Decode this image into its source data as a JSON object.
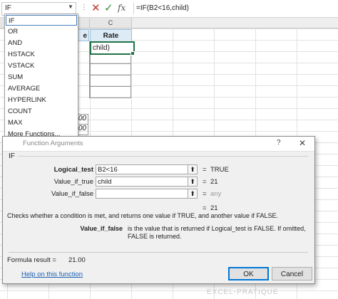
{
  "formula_bar": {
    "name_box": "IF",
    "formula": "=IF(B2<16,child)",
    "fx_label": "fx"
  },
  "columns": [
    "C"
  ],
  "sheet": {
    "header_partial": "e",
    "rate_header": "Rate",
    "active_cell_value": "child)",
    "partial_cells": [
      "00",
      "00"
    ]
  },
  "autocomplete": {
    "items": [
      "IF",
      "OR",
      "AND",
      "HSTACK",
      "VSTACK",
      "SUM",
      "AVERAGE",
      "HYPERLINK",
      "COUNT",
      "MAX",
      "More Functions..."
    ],
    "selected_index": 0
  },
  "dialog": {
    "title": "Function Arguments",
    "help_mark": "?",
    "close_mark": "✕",
    "function_name": "IF",
    "args": [
      {
        "label": "Logical_test",
        "value": "B2<16",
        "result": "TRUE",
        "bold": true
      },
      {
        "label": "Value_if_true",
        "value": "child",
        "result": "21",
        "bold": false
      },
      {
        "label": "Value_if_false",
        "value": "",
        "result": "any",
        "bold": false
      }
    ],
    "equals": "=",
    "overall_result": "21",
    "description": "Checks whether a condition is met, and returns one value if TRUE, and another value if FALSE.",
    "arg_desc_name": "Value_if_false",
    "arg_desc_text": "is the value that is returned if Logical_test is FALSE. If omitted, FALSE is returned.",
    "formula_result_label": "Formula result =",
    "formula_result_value": "21.00",
    "help_link": "Help on this function",
    "ok_label": "OK",
    "cancel_label": "Cancel"
  },
  "watermark": "EXCEL-PRATIQUE",
  "colors": {
    "accent": "#217346",
    "header_fill": "#ddebf7",
    "ok_border": "#0078d7",
    "link": "#1a5fb4"
  }
}
